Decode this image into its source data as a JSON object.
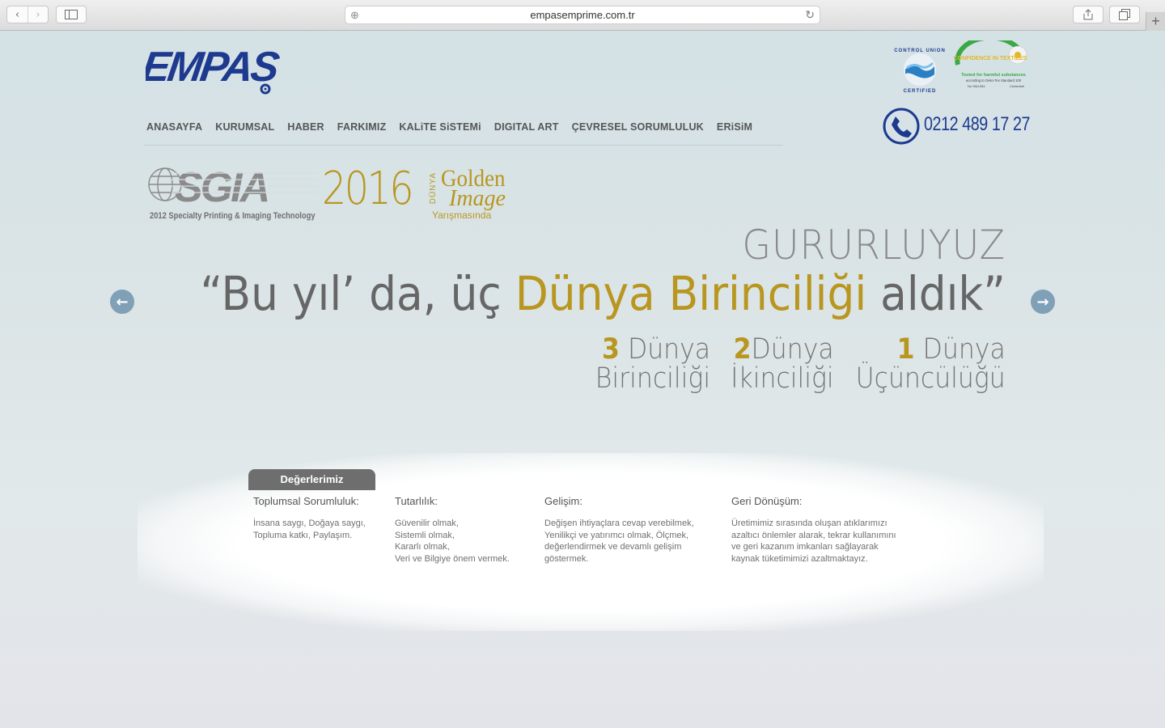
{
  "browser": {
    "url": "empasemprime.com.tr"
  },
  "header": {
    "logo_text": "EMPAS",
    "nav": [
      "ANASAYFA",
      "KURUMSAL",
      "HABER",
      "FARKIMIZ",
      "KALiTE SiSTEMi",
      "DIGITAL ART",
      "ÇEVRESEL SORUMLULUK",
      "ERiSiM"
    ],
    "phone": "0212 489 17 27",
    "cert1_text": "CONTROL UNION CERTIFIED",
    "cert2_lines": [
      "CONFIDENCE IN TEXTILES",
      "Tested for harmful substances",
      "according to Oeko-Tex Standard 100",
      "No 0611054",
      "Centexbel"
    ]
  },
  "slide": {
    "sgia_subtitle": "2012 Specialty Printing & Imaging Technology",
    "year": "2016",
    "dunya_vertical": "DÜNYA",
    "golden": "Golden",
    "image_word": "Image",
    "yarisma": "Yarışmasında",
    "gurur": "GURURLUYUZ",
    "headline_pre": "“Bu yıl’ da, üç ",
    "headline_gold": "Dünya Birinciliği",
    "headline_post": " aldık”",
    "stats": [
      {
        "num": "3",
        "line1": " Dünya",
        "line2": "Birinciliği"
      },
      {
        "num": "2",
        "line1": "Dünya",
        "line2": "İkinciliği"
      },
      {
        "num": "1",
        "line1": " Dünya",
        "line2": "Üçüncülüğü"
      }
    ]
  },
  "values": {
    "tab_label": "Değerlerimiz",
    "columns": [
      {
        "title": "Toplumsal Sorumluluk:",
        "text": "İnsana saygı, Doğaya saygı,\nTopluma katkı, Paylaşım."
      },
      {
        "title": "Tutarlılık:",
        "text": "Güvenilir olmak,\nSistemli olmak,\nKararlı olmak,\nVeri ve Bilgiye önem vermek."
      },
      {
        "title": "Gelişim:",
        "text": "Değişen ihtiyaçlara cevap verebilmek,\nYenilikçi ve yatırımcı olmak, Ölçmek,\ndeğerlendirmek ve devamlı gelişim\ngöstermek."
      },
      {
        "title": "Geri Dönüşüm:",
        "text": "Üretimimiz sırasında oluşan atıklarımızı\nazaltıcı önlemler alarak, tekrar kullanımını\nve geri kazanım imkanları sağlayarak\nkaynak tüketimimizi azaltmaktayız."
      }
    ]
  },
  "colors": {
    "gold": "#b8961f",
    "brand_blue": "#1d3a8f",
    "arrow_blue": "#7fa0b7"
  }
}
